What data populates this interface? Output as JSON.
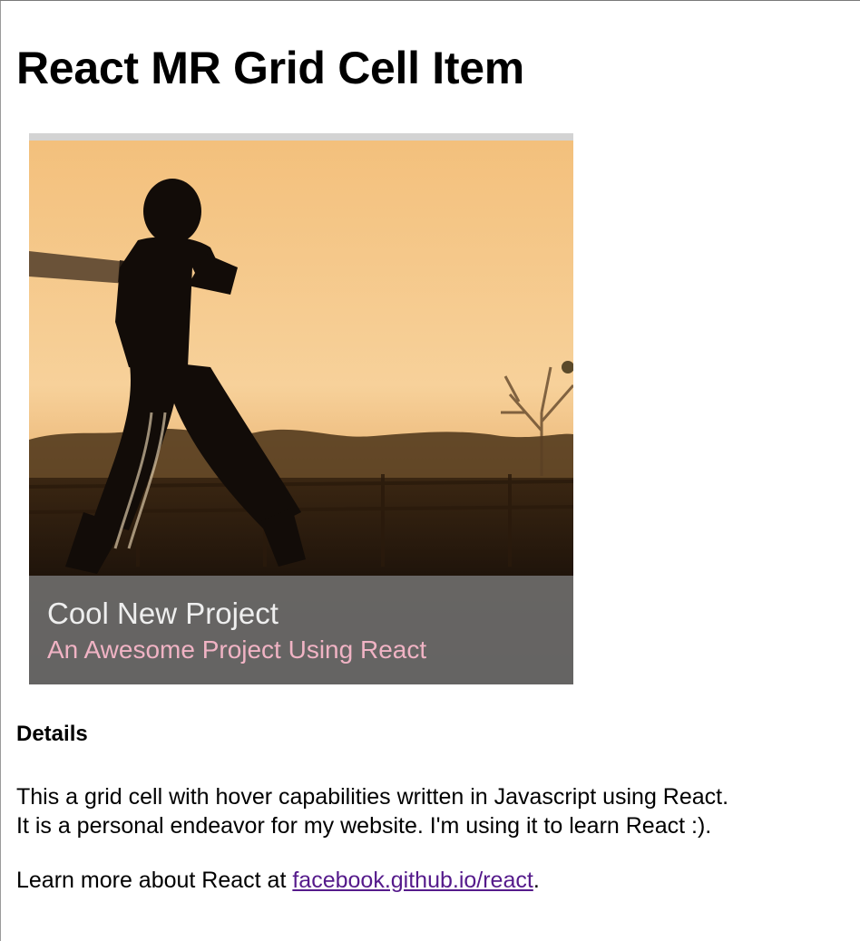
{
  "page": {
    "title": "React MR Grid Cell Item"
  },
  "grid_cell": {
    "title": "Cool New Project",
    "subtitle": "An Awesome Project Using React",
    "image_subject": "cricket batsman silhouette at sunset"
  },
  "details": {
    "heading": "Details",
    "line1": "This a grid cell with hover capabilities written in Javascript using React.",
    "line2": "It is a personal endeavor for my website. I'm using it to learn React :).",
    "learn_prefix": "Learn more about React at ",
    "link_text": "facebook.github.io/react",
    "learn_suffix": "."
  },
  "colors": {
    "subtitle": "#f0b3c4",
    "link": "#551a8b",
    "overlay": "#787878"
  }
}
